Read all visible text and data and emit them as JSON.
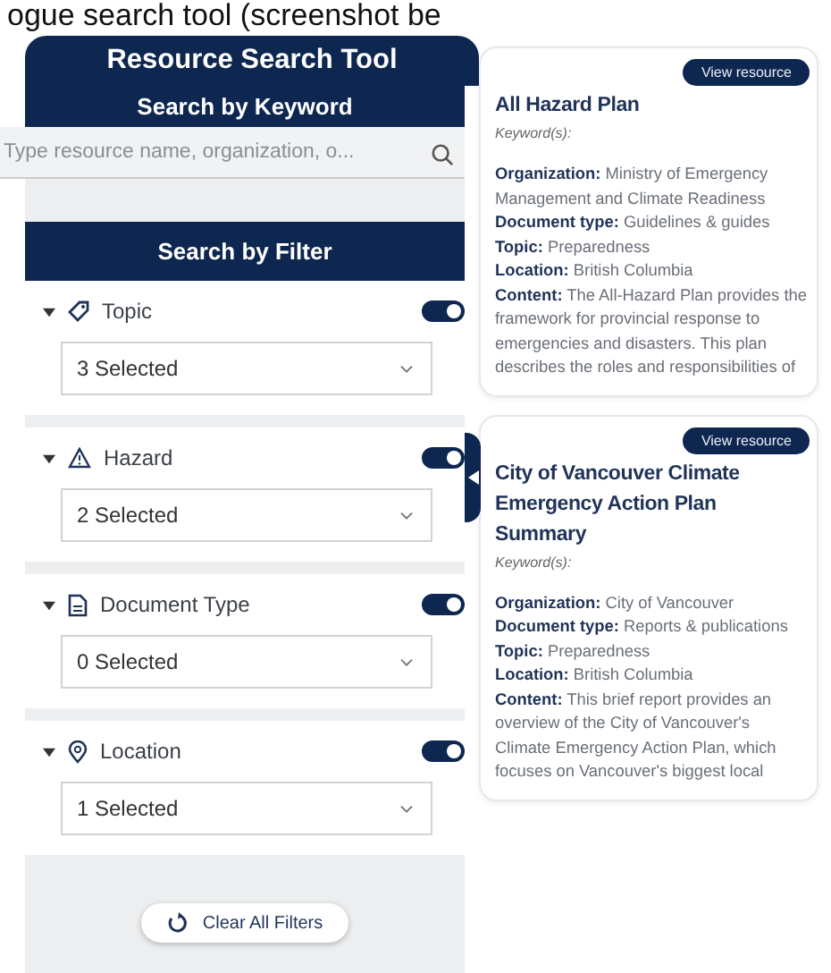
{
  "caption": "ogue search tool (screenshot be",
  "title": "Resource Search Tool",
  "keyword_section": {
    "heading": "Search by Keyword",
    "search": {
      "placeholder": "Type resource name, organization, o..."
    }
  },
  "filter_section": {
    "heading": "Search by Filter",
    "filters": [
      {
        "kind": "tag",
        "label": "Topic",
        "expanded": true,
        "on": true,
        "value": "3 Selected"
      },
      {
        "kind": "hazard",
        "label": "Hazard",
        "expanded": true,
        "on": true,
        "value": "2 Selected"
      },
      {
        "kind": "document",
        "label": "Document Type",
        "expanded": true,
        "on": true,
        "value": "0 Selected"
      },
      {
        "kind": "location",
        "label": "Location",
        "expanded": true,
        "on": true,
        "value": "1 Selected"
      }
    ]
  },
  "clear_button": "Clear All Filters",
  "results": [
    {
      "button": "View resource",
      "title": "All Hazard Plan",
      "keywords": "Keyword(s):",
      "fields": [
        "**Organization:** Ministry of Emergency Management and Climate Readiness",
        "**Document type:** Guidelines & guides",
        "**Topic:** Preparedness",
        "**Location:** British Columbia",
        "**Content:** The All-Hazard Plan provides the framework for provincial response to emergencies and disasters. This plan describes the roles and responsibilities of"
      ]
    },
    {
      "button": "View resource",
      "title": "City of Vancouver Climate Emergency Action Plan Summary",
      "keywords": "Keyword(s):",
      "fields": [
        "**Organization:** City of Vancouver",
        "**Document type:** Reports & publications",
        "**Topic:** Preparedness",
        "**Location:** British Columbia",
        "**Content:** This brief report provides an overview of the City of Vancouver's Climate Emergency Action Plan, which focuses on Vancouver's biggest local"
      ]
    }
  ]
}
